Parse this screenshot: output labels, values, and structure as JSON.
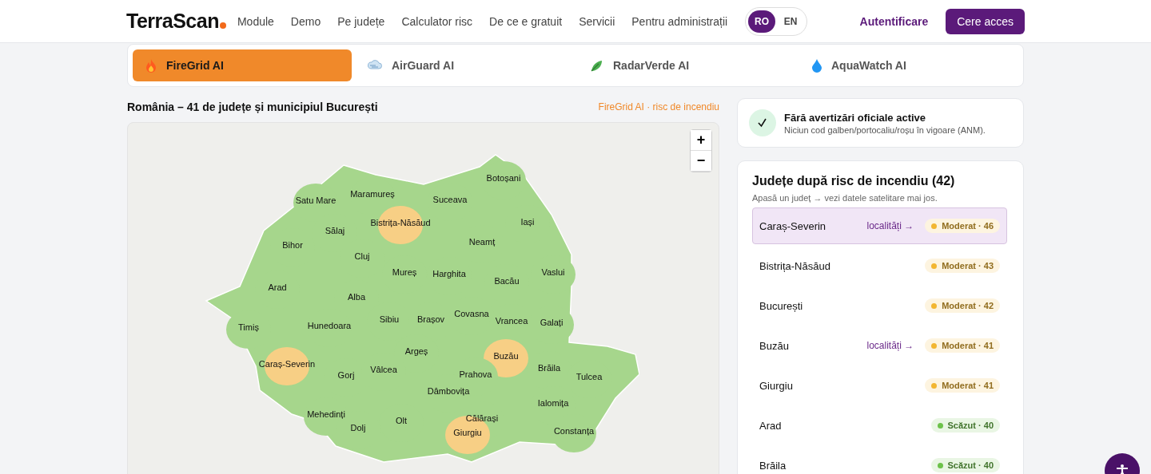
{
  "header": {
    "logo": "TerraScan",
    "nav": [
      "Module",
      "Demo",
      "Pe județe",
      "Calculator risc",
      "De ce e gratuit",
      "Servicii",
      "Pentru administrații"
    ],
    "languages": [
      {
        "label": "RO",
        "selected": true
      },
      {
        "label": "EN",
        "selected": false
      }
    ],
    "login": "Autentificare",
    "cta": "Cere acces"
  },
  "products": [
    {
      "kind": "fire",
      "label": "FireGrid AI",
      "selected": true
    },
    {
      "kind": "air",
      "label": "AirGuard AI",
      "selected": false
    },
    {
      "kind": "radar",
      "label": "RadarVerde AI",
      "selected": false
    },
    {
      "kind": "water",
      "label": "AquaWatch AI",
      "selected": false
    }
  ],
  "map": {
    "title": "România – 41 de județe și municipiul București",
    "layer": "FireGrid AI · risc de incendiu",
    "zoom_in": "+",
    "zoom_out": "−",
    "counties": [
      {
        "name": "Botoșani",
        "color": "#a6d68c"
      },
      {
        "name": "Maramureș",
        "color": "#a6d68c"
      },
      {
        "name": "Satu Mare",
        "color": "#a6d68c"
      },
      {
        "name": "Suceava",
        "color": "#a6d68c"
      },
      {
        "name": "Bistrița-Năsăud",
        "color": "#f7cf85"
      },
      {
        "name": "Iași",
        "color": "#a6d68c"
      },
      {
        "name": "Sălaj",
        "color": "#a6d68c"
      },
      {
        "name": "Neamț",
        "color": "#a6d68c"
      },
      {
        "name": "Bihor",
        "color": "#a6d68c"
      },
      {
        "name": "Cluj",
        "color": "#a6d68c"
      },
      {
        "name": "Mureș",
        "color": "#a6d68c"
      },
      {
        "name": "Harghita",
        "color": "#a6d68c"
      },
      {
        "name": "Vaslui",
        "color": "#a6d68c"
      },
      {
        "name": "Bacău",
        "color": "#a6d68c"
      },
      {
        "name": "Arad",
        "color": "#a6d68c"
      },
      {
        "name": "Alba",
        "color": "#a6d68c"
      },
      {
        "name": "Sibiu",
        "color": "#a6d68c"
      },
      {
        "name": "Brașov",
        "color": "#a6d68c"
      },
      {
        "name": "Covasna",
        "color": "#a6d68c"
      },
      {
        "name": "Vrancea",
        "color": "#a6d68c"
      },
      {
        "name": "Galați",
        "color": "#a6d68c"
      },
      {
        "name": "Timiș",
        "color": "#a6d68c"
      },
      {
        "name": "Hunedoara",
        "color": "#a6d68c"
      },
      {
        "name": "Argeș",
        "color": "#a6d68c"
      },
      {
        "name": "Buzău",
        "color": "#f7cf85"
      },
      {
        "name": "Caraș-Severin",
        "color": "#f7cf85"
      },
      {
        "name": "Gorj",
        "color": "#a6d68c"
      },
      {
        "name": "Vâlcea",
        "color": "#a6d68c"
      },
      {
        "name": "Prahova",
        "color": "#a6d68c"
      },
      {
        "name": "Brăila",
        "color": "#a6d68c"
      },
      {
        "name": "Tulcea",
        "color": "#a6d68c"
      },
      {
        "name": "Dâmbovița",
        "color": "#a6d68c"
      },
      {
        "name": "Ialomița",
        "color": "#a6d68c"
      },
      {
        "name": "Mehedinți",
        "color": "#a6d68c"
      },
      {
        "name": "Olt",
        "color": "#a6d68c"
      },
      {
        "name": "Călărași",
        "color": "#a6d68c"
      },
      {
        "name": "Dolj",
        "color": "#a6d68c"
      },
      {
        "name": "Giurgiu",
        "color": "#f7cf85"
      },
      {
        "name": "Constanța",
        "color": "#a6d68c"
      }
    ]
  },
  "alert": {
    "title": "Fără avertizări oficiale active",
    "text": "Niciun cod galben/portocaliu/roșu în vigoare (ANM)."
  },
  "ranking": {
    "title": "Județe după risc de incendiu (42)",
    "hint": "Apasă un județ → vezi datele satelitare mai jos.",
    "rows": [
      {
        "name": "Caraș-Severin",
        "link": "localități →",
        "color": "#f2b632",
        "badge": "Moderat · 46",
        "selected": true
      },
      {
        "name": "Bistrița-Năsăud",
        "color": "#f2b632",
        "badge": "Moderat · 43",
        "selected": false
      },
      {
        "name": "București",
        "color": "#f2b632",
        "badge": "Moderat · 42",
        "selected": false
      },
      {
        "name": "Buzău",
        "link": "localități →",
        "color": "#f2b632",
        "badge": "Moderat · 41",
        "selected": false
      },
      {
        "name": "Giurgiu",
        "color": "#f2b632",
        "badge": "Moderat · 41",
        "selected": false
      },
      {
        "name": "Arad",
        "color": "#6cc24a",
        "badge": "Scăzut · 40",
        "selected": false
      },
      {
        "name": "Brăila",
        "color": "#6cc24a",
        "badge": "Scăzut · 40",
        "selected": false
      }
    ]
  }
}
